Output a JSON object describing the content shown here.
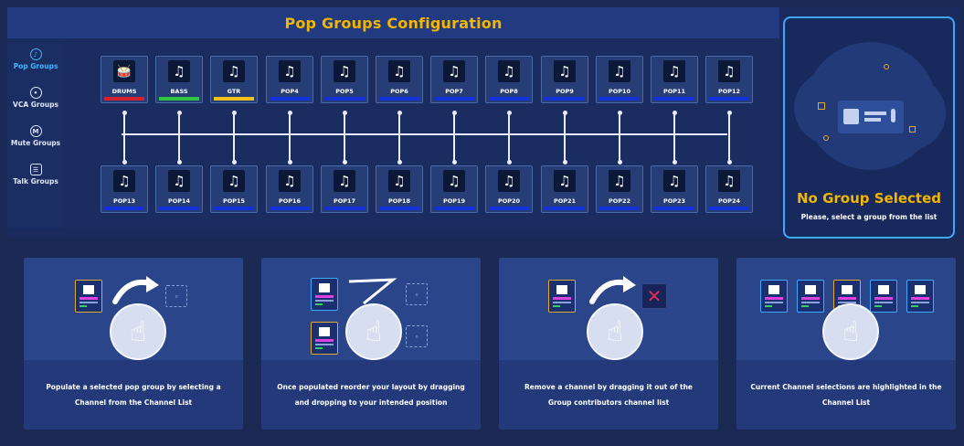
{
  "header": {
    "title": "Pop Groups Configuration"
  },
  "sidebar": {
    "items": [
      {
        "label": "Pop Groups",
        "active": true,
        "icon": "music-note-icon"
      },
      {
        "label": "VCA Groups",
        "active": false,
        "icon": "knob-icon"
      },
      {
        "label": "Mute Groups",
        "active": false,
        "icon": "mute-m-icon"
      },
      {
        "label": "Talk Groups",
        "active": false,
        "icon": "talkback-icon"
      }
    ]
  },
  "groups": {
    "row1": [
      {
        "label": "DRUMS",
        "bar": "#d42030",
        "icon": "drum-kit-icon"
      },
      {
        "label": "BASS",
        "bar": "#2ec640",
        "icon": "music-note-icon"
      },
      {
        "label": "GTR",
        "bar": "#f2c21a",
        "icon": "music-note-icon"
      },
      {
        "label": "POP4",
        "bar": "#1530d8",
        "icon": "music-note-icon"
      },
      {
        "label": "POP5",
        "bar": "#1530d8",
        "icon": "music-note-icon"
      },
      {
        "label": "POP6",
        "bar": "#1530d8",
        "icon": "music-note-icon"
      },
      {
        "label": "POP7",
        "bar": "#1530d8",
        "icon": "music-note-icon"
      },
      {
        "label": "POP8",
        "bar": "#1530d8",
        "icon": "music-note-icon"
      },
      {
        "label": "POP9",
        "bar": "#1530d8",
        "icon": "music-note-icon"
      },
      {
        "label": "POP10",
        "bar": "#1530d8",
        "icon": "music-note-icon"
      },
      {
        "label": "POP11",
        "bar": "#1530d8",
        "icon": "music-note-icon"
      },
      {
        "label": "POP12",
        "bar": "#1530d8",
        "icon": "music-note-icon"
      }
    ],
    "row2": [
      {
        "label": "POP13",
        "bar": "#1530d8"
      },
      {
        "label": "POP14",
        "bar": "#1530d8"
      },
      {
        "label": "POP15",
        "bar": "#1530d8"
      },
      {
        "label": "POP16",
        "bar": "#1530d8"
      },
      {
        "label": "POP17",
        "bar": "#1530d8"
      },
      {
        "label": "POP18",
        "bar": "#1530d8"
      },
      {
        "label": "POP19",
        "bar": "#1530d8"
      },
      {
        "label": "POP20",
        "bar": "#1530d8"
      },
      {
        "label": "POP21",
        "bar": "#1530d8"
      },
      {
        "label": "POP22",
        "bar": "#1530d8"
      },
      {
        "label": "POP23",
        "bar": "#1530d8"
      },
      {
        "label": "POP24",
        "bar": "#1530d8"
      }
    ]
  },
  "side_panel": {
    "title": "No Group Selected",
    "subtitle": "Please, select a group from the list"
  },
  "help_cards": [
    {
      "text": "Populate a selected pop group by selecting a Channel from the Channel List"
    },
    {
      "text": "Once populated reorder your layout by dragging and dropping to your intended position"
    },
    {
      "text": "Remove a channel by dragging it out of the Group contributors channel list"
    },
    {
      "text": "Current Channel selections are highlighted in the Channel List"
    }
  ],
  "colors": {
    "accent": "#f2b500",
    "active_nav": "#42b4ff",
    "panel_border": "#3ea8ff",
    "remove": "#e03050"
  }
}
